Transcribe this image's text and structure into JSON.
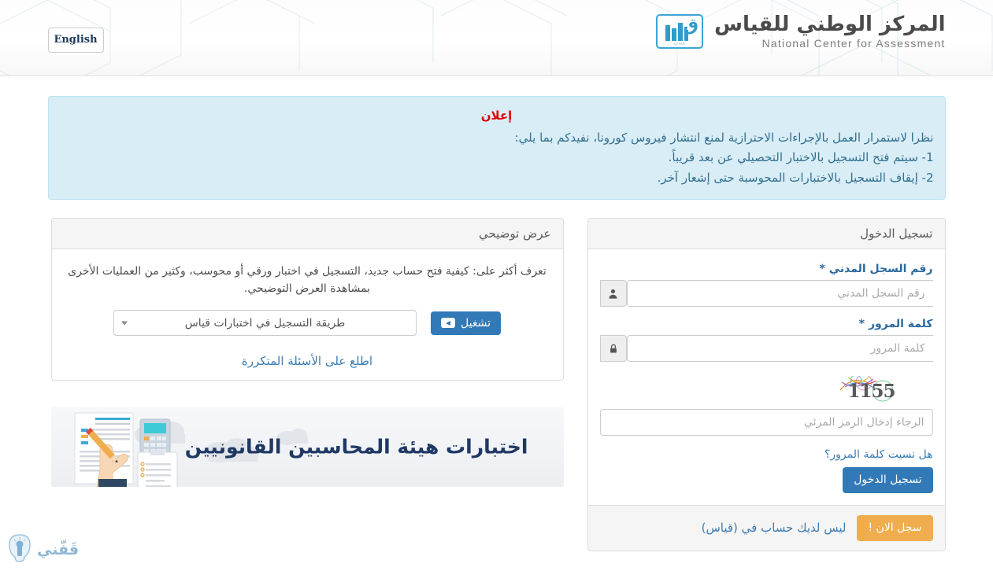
{
  "header": {
    "language_button": "English",
    "brand_arabic": "المركز الوطني للقياس",
    "brand_english": "National Center for Assessment",
    "brand_mark_caption": "QIYAS",
    "brand_mark_letter": "ق"
  },
  "alert": {
    "title": "إعلان",
    "lines": [
      "نظرا لاستمرار العمل بالإجراءات الاحترازية لمنع انتشار فيروس كورونا، نفيدكم بما يلي:",
      "1-  سيتم فتح التسجيل بالاختبار التحصيلي عن بعد قريباً.",
      "2- إيقاف التسجيل بالاختبارات المحوسبة حتى إشعار آخر."
    ]
  },
  "login": {
    "panel_title": "تسجيل الدخول",
    "civil_id_label": "رقم السجل المدني *",
    "civil_id_placeholder": "رقم السجل المدني",
    "civil_id_value": "",
    "civil_id_icon": "user-icon",
    "password_label": "كلمة المرور *",
    "password_placeholder": "كلمة المرور",
    "password_value": "",
    "password_icon": "lock-icon",
    "captcha_code": "1155",
    "captcha_placeholder": "الرجاء إدخال الرمز المرئي",
    "captcha_value": "",
    "forgot_password": "هل نسيت كلمة المرور؟",
    "submit_button": "تسجيل الدخول",
    "footer_text": "ليس لديك حساب في (قياس)",
    "footer_button": "سجل الان !"
  },
  "demo": {
    "panel_title": "عرض توضيحي",
    "description": "تعرف أكثر على: كيفية فتح حساب جديد، التسجيل في اختبار ورقي أو محوسب، وكثير من العمليات الأخرى بمشاهدة العرض التوضيحي.",
    "select_value": "طريقة التسجيل في اختبارات قياس",
    "play_button": "تشغيل",
    "play_icon": "youtube-play-icon",
    "faq_link": "اطلع على الأسئلة المتكررة"
  },
  "promo": {
    "title": "اختبارات هيئة المحاسبين القانونيين"
  },
  "bottom_logo": {
    "word": "قَفّني",
    "icon": "lightbulb-icon"
  },
  "colors": {
    "primary_blue": "#3279b7",
    "link_blue": "#3b7cb3",
    "label_blue": "#2b6a9e",
    "warning_orange": "#f0ad4e",
    "alert_bg": "#d9edf7",
    "alert_border": "#bce3f0",
    "alert_text": "#31708f",
    "alert_title_red": "#e10000",
    "brand_cyan": "#2e9ccc",
    "promo_title": "#1f3864",
    "panel_border": "#dddddd",
    "panel_head_bg": "#f5f5f5"
  }
}
